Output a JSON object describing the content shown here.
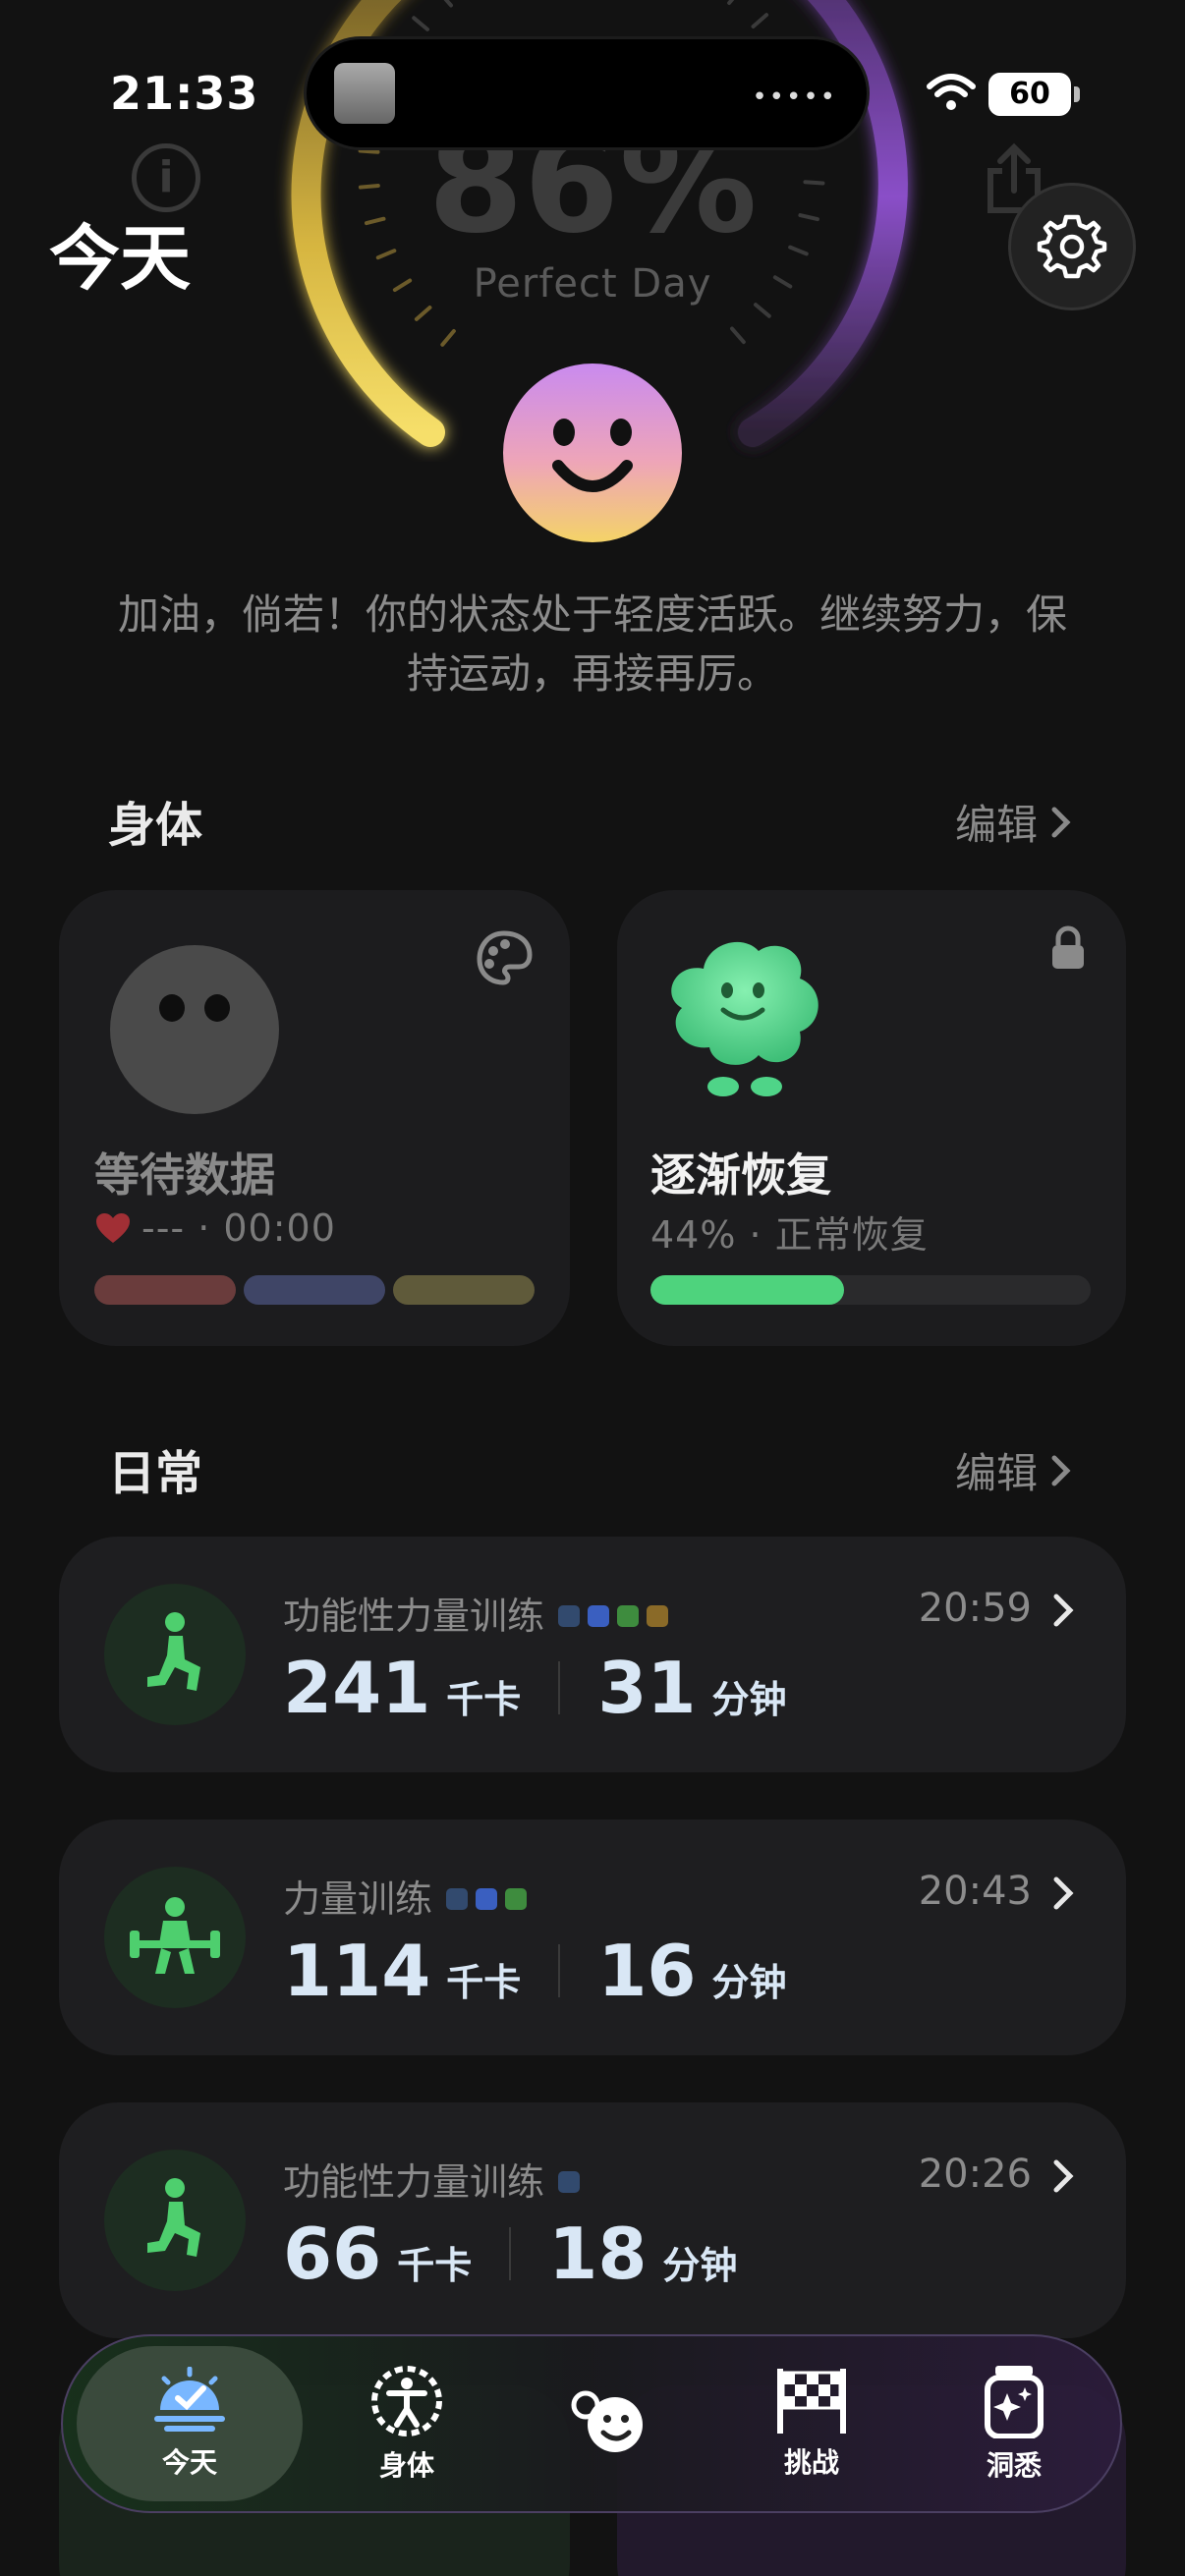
{
  "status_bar": {
    "time": "21:33",
    "battery": "60",
    "island_dots": "•••••"
  },
  "header": {
    "title": "今天",
    "info_icon": "info-icon",
    "share_icon": "share-icon",
    "settings_icon": "gear-icon"
  },
  "gauge": {
    "percent": "86%",
    "label": "Perfect Day",
    "score": 86
  },
  "message": "加油，倘若！你的状态处于轻度活跃。继续努力，保持运动，再接再厉。",
  "body_section": {
    "title": "身体",
    "edit": "编辑",
    "cards": [
      {
        "title": "等待数据",
        "subtitle": "--- · 00:00",
        "icon": "palette-icon",
        "segments": [
          "#6a3c3c",
          "#3f4566",
          "#5f5a3a"
        ]
      },
      {
        "title": "逐渐恢复",
        "subtitle": "44% · 正常恢复",
        "icon": "lock-icon",
        "progress": 0.44
      }
    ]
  },
  "daily_section": {
    "title": "日常",
    "edit": "编辑",
    "rows": [
      {
        "name": "功能性力量训练",
        "tags": [
          "#324a6e",
          "#3a5fc0",
          "#3e8c3e",
          "#8a6a28"
        ],
        "time": "20:59",
        "kcal": "241",
        "kcal_unit": "千卡",
        "mins": "31",
        "mins_unit": "分钟",
        "icon": "lunge-icon"
      },
      {
        "name": "力量训练",
        "tags": [
          "#324a6e",
          "#3a5fc0",
          "#3e8c3e"
        ],
        "time": "20:43",
        "kcal": "114",
        "kcal_unit": "千卡",
        "mins": "16",
        "mins_unit": "分钟",
        "icon": "weightlifting-icon"
      },
      {
        "name": "功能性力量训练",
        "tags": [
          "#324a6e"
        ],
        "time": "20:26",
        "kcal": "66",
        "kcal_unit": "千卡",
        "mins": "18",
        "mins_unit": "分钟",
        "icon": "lunge-icon"
      }
    ]
  },
  "tabbar": {
    "tabs": [
      {
        "label": "今天",
        "icon": "sunrise-check-icon",
        "active": true
      },
      {
        "label": "身体",
        "icon": "body-icon",
        "active": false
      },
      {
        "label": "",
        "icon": "mood-face-icon",
        "active": false
      },
      {
        "label": "挑战",
        "icon": "checkered-flag-icon",
        "active": false
      },
      {
        "label": "洞悉",
        "icon": "sparkle-jar-icon",
        "active": false
      }
    ]
  },
  "colors": {
    "accent_green": "#4ed37d",
    "gauge_yellow": "#f3d34a",
    "gauge_purple": "#8e4fd0"
  }
}
